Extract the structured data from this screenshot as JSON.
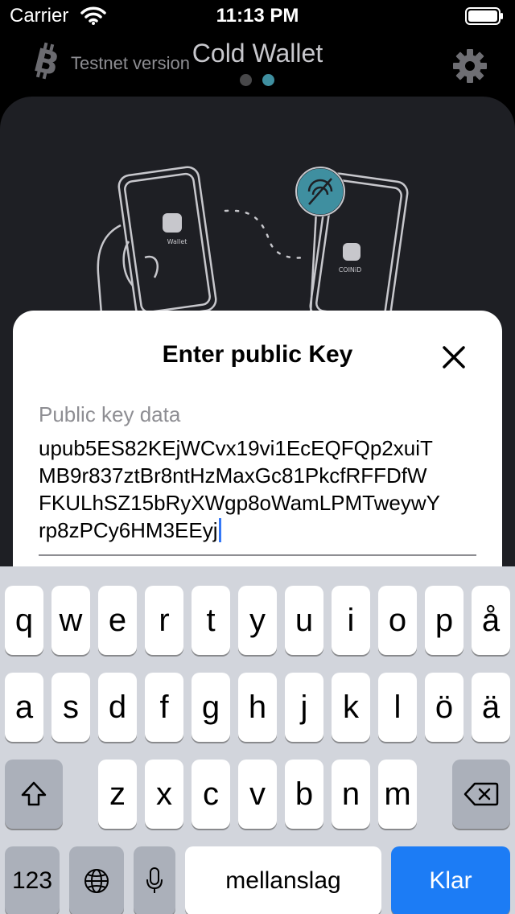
{
  "status_bar": {
    "carrier": "Carrier",
    "time": "11:13 PM"
  },
  "header": {
    "badge": "Testnet version",
    "title": "Cold Wallet",
    "logo_icon": "bitcoin-logo-icon",
    "settings_icon": "gear-icon",
    "page_indicator": {
      "total": 2,
      "active": 2
    }
  },
  "illustration": {
    "phone_left_label": "Wallet",
    "phone_right_label": "COINiD"
  },
  "modal": {
    "title": "Enter public Key",
    "field_label": "Public key data",
    "field_value_lines": [
      "upub5ES82KEjWCvx19vi1EcEQFQp2xuiT",
      "MB9r837ztBr8ntHzMaxGc81PkcfRFFDfW",
      "FKULhSZ15bRyXWgp8oWamLPMTweywY",
      "rp8zPCy6HM3EEyj"
    ]
  },
  "keyboard": {
    "row1": [
      "q",
      "w",
      "e",
      "r",
      "t",
      "y",
      "u",
      "i",
      "o",
      "p",
      "å"
    ],
    "row2": [
      "a",
      "s",
      "d",
      "f",
      "g",
      "h",
      "j",
      "k",
      "l",
      "ö",
      "ä"
    ],
    "row3": [
      "z",
      "x",
      "c",
      "v",
      "b",
      "n",
      "m"
    ],
    "numbers_label": "123",
    "space_label": "mellanslag",
    "return_label": "Klar"
  },
  "colors": {
    "accent": "#1c7cf5",
    "indicator_active": "#3f8fa0",
    "card_bg": "#1e1f24"
  }
}
